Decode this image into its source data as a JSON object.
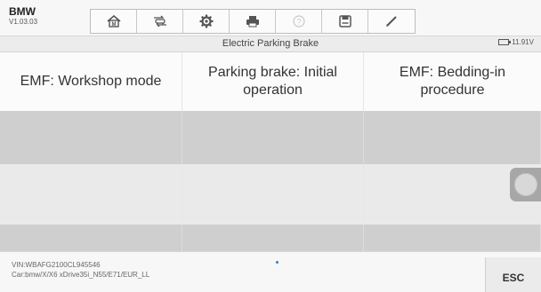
{
  "header": {
    "app_name": "BMW",
    "version": "V1.03.03"
  },
  "toolbar": {
    "buttons": [
      {
        "icon": "home-icon"
      },
      {
        "icon": "vehicle-swap-icon"
      },
      {
        "icon": "settings-gear-icon"
      },
      {
        "icon": "print-icon"
      },
      {
        "icon": "help-icon",
        "disabled": true
      },
      {
        "icon": "save-icon"
      },
      {
        "icon": "pen-icon"
      }
    ]
  },
  "title_bar": {
    "title": "Electric Parking Brake",
    "battery_voltage": "11.91V"
  },
  "menu": {
    "items": [
      {
        "label": "EMF: Workshop mode"
      },
      {
        "label": "Parking brake: Initial operation"
      },
      {
        "label": "EMF: Bedding-in procedure"
      }
    ]
  },
  "footer": {
    "vin": "VIN:WBAFG2100CL945546",
    "car": "Car:bmw/X/X6 xDrive35i_N55/E71/EUR_LL",
    "esc_label": "ESC"
  },
  "colors": {
    "accent_dot": "#3a7bd5",
    "toolbar_bg": "#f7f7f7",
    "row_dark": "#cfcfcf",
    "row_light": "#eaeaea"
  }
}
